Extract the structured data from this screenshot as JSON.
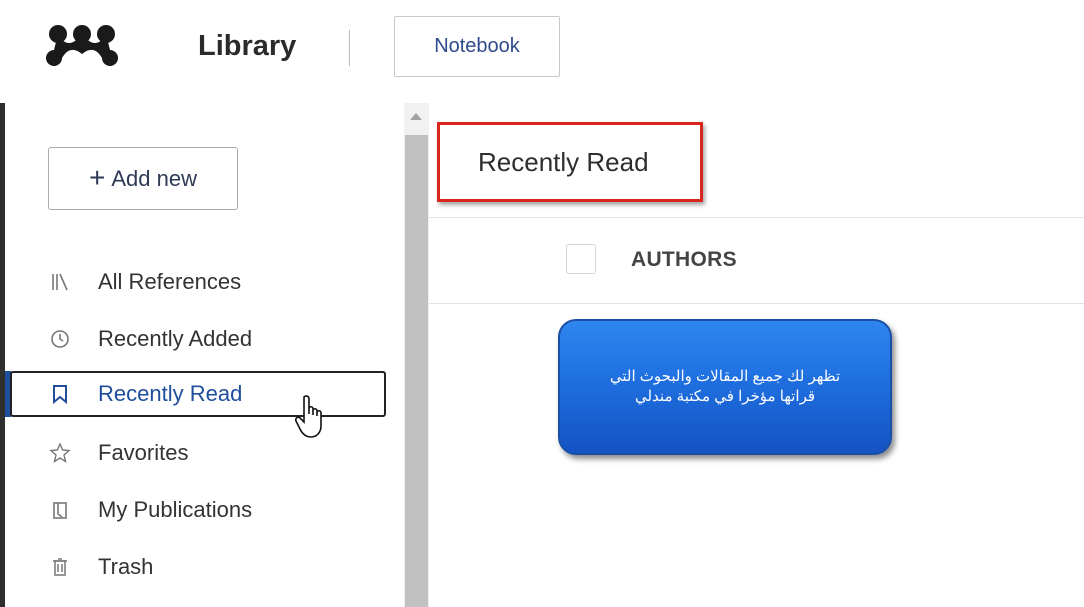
{
  "header": {
    "title": "Library",
    "notebook_label": "Notebook"
  },
  "sidebar": {
    "add_new_label": "Add new",
    "items": [
      {
        "label": "All References",
        "icon": "library-icon"
      },
      {
        "label": "Recently Added",
        "icon": "clock-icon"
      },
      {
        "label": "Recently Read",
        "icon": "bookmark-icon",
        "active": true
      },
      {
        "label": "Favorites",
        "icon": "star-icon"
      },
      {
        "label": "My Publications",
        "icon": "publications-icon"
      },
      {
        "label": "Trash",
        "icon": "trash-icon"
      }
    ]
  },
  "main": {
    "section_title": "Recently Read",
    "columns": [
      "AUTHORS"
    ]
  },
  "callout": {
    "line1": "تظهر لك جميع المقالات والبحوث التي",
    "line2": "قراتها مؤخرا في مكتبة مندلي"
  },
  "colors": {
    "accent": "#1f4e9c",
    "highlight_border": "#d8261b",
    "callout_bg": "#1f6fe0"
  }
}
